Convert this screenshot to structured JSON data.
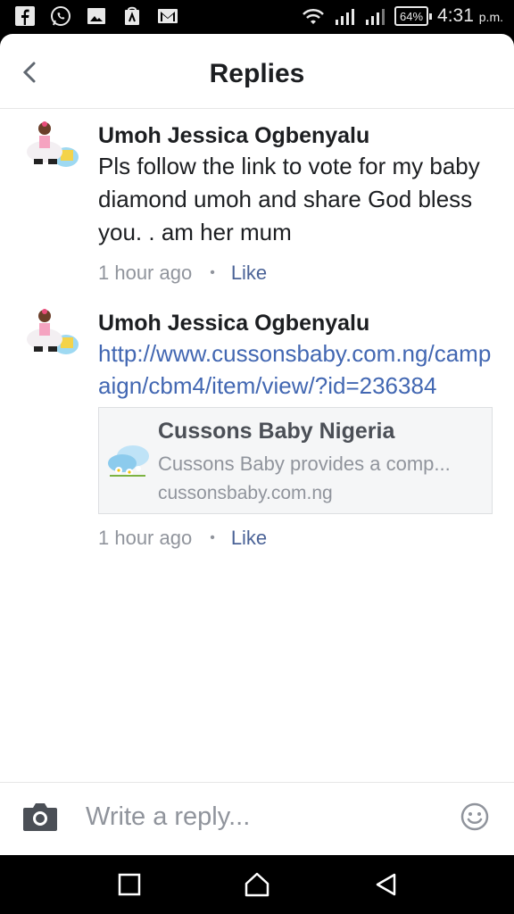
{
  "status_bar": {
    "battery": "64%",
    "time": "4:31",
    "ampm": "p.m."
  },
  "header": {
    "title": "Replies"
  },
  "comments": [
    {
      "author": "Umoh Jessica Ogbenyalu",
      "text": "Pls follow the link to vote for my baby diamond umoh and share God bless you. . am her mum",
      "time": "1 hour ago",
      "like_label": "Like"
    },
    {
      "author": "Umoh Jessica Ogbenyalu",
      "link": "http://www.cussonsbaby.com.ng/campaign/cbm4/item/view/?id=236384",
      "preview": {
        "title": "Cussons Baby Nigeria",
        "description": "Cussons Baby provides a comp...",
        "domain": "cussonsbaby.com.ng"
      },
      "time": "1 hour ago",
      "like_label": "Like"
    }
  ],
  "reply_bar": {
    "placeholder": "Write a reply..."
  },
  "colors": {
    "link": "#4267b2",
    "meta": "#90949c"
  }
}
